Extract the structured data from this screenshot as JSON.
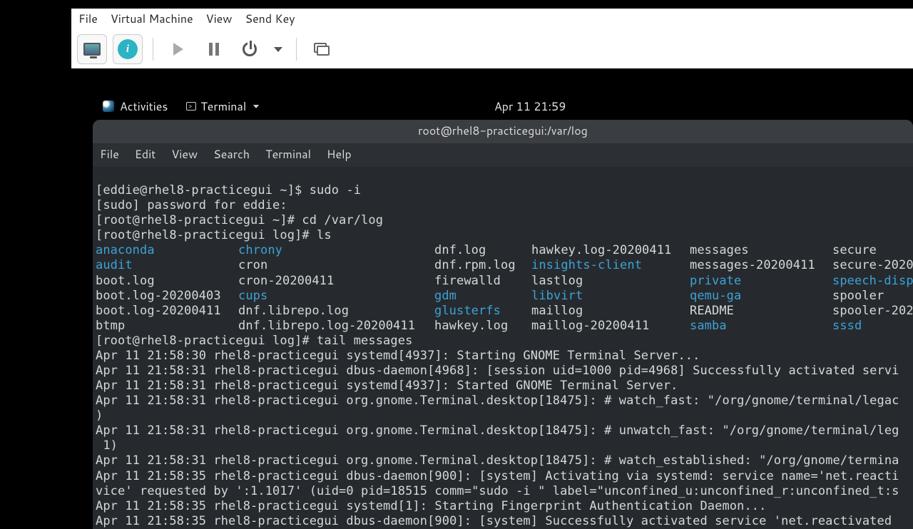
{
  "vm": {
    "menu": {
      "file": "File",
      "virtual_machine": "Virtual Machine",
      "view": "View",
      "send_key": "Send Key"
    }
  },
  "gnome": {
    "activities": "Activities",
    "app_name": "Terminal",
    "clock": "Apr 11  21:59"
  },
  "terminal": {
    "title": "root@rhel8-practicegui:/var/log",
    "menu": {
      "file": "File",
      "edit": "Edit",
      "view": "View",
      "search": "Search",
      "terminal": "Terminal",
      "help": "Help"
    },
    "lines": {
      "l1": "[eddie@rhel8-practicegui ~]$ sudo -i",
      "l2": "[sudo] password for eddie:",
      "l3": "[root@rhel8-practicegui ~]# cd /var/log",
      "l4": "[root@rhel8-practicegui log]# ls",
      "l5": "[root@rhel8-practicegui log]# tail messages",
      "m1": "Apr 11 21:58:30 rhel8-practicegui systemd[4937]: Starting GNOME Terminal Server...",
      "m2": "Apr 11 21:58:31 rhel8-practicegui dbus-daemon[4968]: [session uid=1000 pid=4968] Successfully activated servi",
      "m3": "Apr 11 21:58:31 rhel8-practicegui systemd[4937]: Started GNOME Terminal Server.",
      "m4": "Apr 11 21:58:31 rhel8-practicegui org.gnome.Terminal.desktop[18475]: # watch_fast: \"/org/gnome/terminal/legac",
      "m4b": ")",
      "m5": "Apr 11 21:58:31 rhel8-practicegui org.gnome.Terminal.desktop[18475]: # unwatch_fast: \"/org/gnome/terminal/leg",
      "m5b": " 1)",
      "m6": "Apr 11 21:58:31 rhel8-practicegui org.gnome.Terminal.desktop[18475]: # watch_established: \"/org/gnome/termina",
      "m7": "Apr 11 21:58:35 rhel8-practicegui dbus-daemon[900]: [system] Activating via systemd: service name='net.reacti",
      "m7b": "vice' requested by ':1.1017' (uid=0 pid=18515 comm=\"sudo -i \" label=\"unconfined_u:unconfined_r:unconfined_t:s",
      "m8": "Apr 11 21:58:35 rhel8-practicegui systemd[1]: Starting Fingerprint Authentication Daemon...",
      "m9": "Apr 11 21:58:35 rhel8-practicegui dbus-daemon[900]: [system] Successfully activated service 'net.reactivated"
    },
    "ls": {
      "r1": {
        "c1": "anaconda",
        "c2": "chrony",
        "c3": "dnf.log",
        "c4": "hawkey.log-20200411",
        "c5": "messages",
        "c6": "secure"
      },
      "r2": {
        "c1": "audit",
        "c2": "cron",
        "c3": "dnf.rpm.log",
        "c4": "insights-client",
        "c5": "messages-20200411",
        "c6": "secure-2020"
      },
      "r3": {
        "c1": "boot.log",
        "c2": "cron-20200411",
        "c3": "firewalld",
        "c4": "lastlog",
        "c5": "private",
        "c6": "speech-disp"
      },
      "r4": {
        "c1": "boot.log-20200403",
        "c2": "cups",
        "c3": "gdm",
        "c4": "libvirt",
        "c5": "qemu-ga",
        "c6": "spooler"
      },
      "r5": {
        "c1": "boot.log-20200411",
        "c2": "dnf.librepo.log",
        "c3": "glusterfs",
        "c4": "maillog",
        "c5": "README",
        "c6": "spooler-202"
      },
      "r6": {
        "c1": "btmp",
        "c2": "dnf.librepo.log-20200411",
        "c3": "hawkey.log",
        "c4": "maillog-20200411",
        "c5": "samba",
        "c6": "sssd"
      }
    }
  }
}
